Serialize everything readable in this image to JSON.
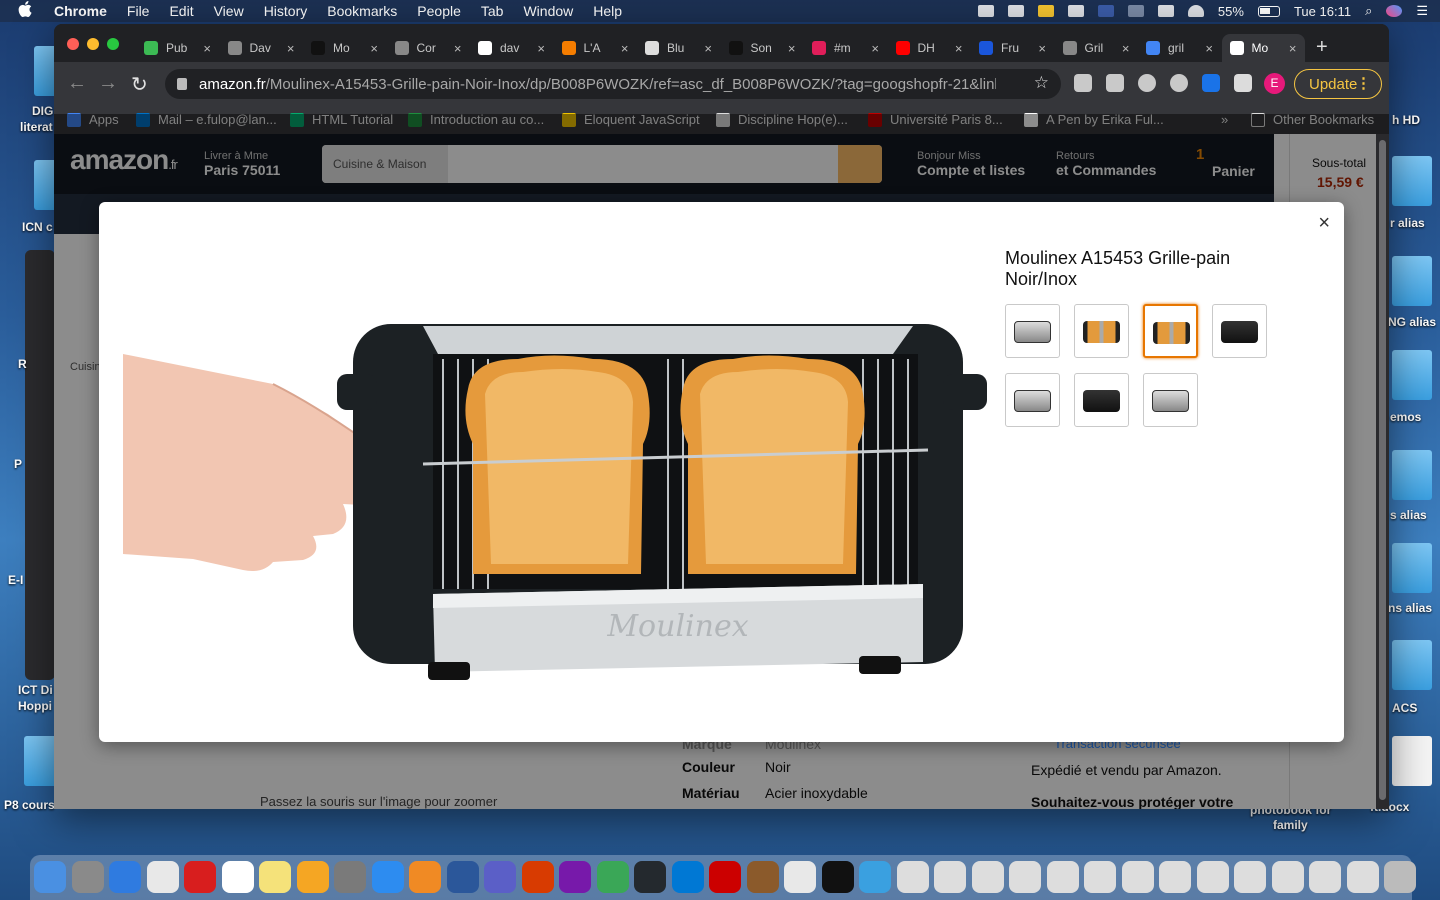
{
  "menubar": {
    "apple": "",
    "app": "Chrome",
    "items": [
      "File",
      "Edit",
      "View",
      "History",
      "Bookmarks",
      "People",
      "Tab",
      "Window",
      "Help"
    ],
    "battery": "55%",
    "clock": "Tue 16:11"
  },
  "desktop": {
    "labels": [
      "DIG",
      "literat",
      "ICN c",
      "R",
      "P",
      "E-I",
      "ICT Di",
      "Hoppi",
      "P8 cours",
      "h HD",
      "r alias",
      "NG alias",
      "emos",
      "s alias",
      "ns alias",
      "ACS",
      "photobook for",
      "family",
      "ft.docx"
    ]
  },
  "browser": {
    "tabs": [
      {
        "title": "Pub",
        "color": "#3cba54"
      },
      {
        "title": "Dav",
        "color": "#888888"
      },
      {
        "title": "Mo",
        "color": "#111111"
      },
      {
        "title": "Cor",
        "color": "#888888"
      },
      {
        "title": "dav",
        "color": "#ffffff"
      },
      {
        "title": "L'A",
        "color": "#f57d00"
      },
      {
        "title": "Blu",
        "color": "#dddddd"
      },
      {
        "title": "Son",
        "color": "#111111"
      },
      {
        "title": "#m",
        "color": "#e01e5a"
      },
      {
        "title": "DH",
        "color": "#ff0000"
      },
      {
        "title": "Fru",
        "color": "#1a56db"
      },
      {
        "title": "Gril",
        "color": "#888888"
      },
      {
        "title": "gril",
        "color": "#4285f4"
      },
      {
        "title": "Mo",
        "color": "#ffffff"
      }
    ],
    "active_tab": 13,
    "close_glyph": "×",
    "new_tab": "+",
    "url_host": "amazon.fr",
    "url_path": "/Moulinex-A15453-Grille-pain-Noir-Inox/dp/B008P6WOZK/ref=asc_df_B008P6WOZK/?tag=googshopfr-21&linkC...",
    "profile_initial": "E",
    "update_label": "Update",
    "bookmarks": [
      {
        "label": "Apps",
        "color": "#4285f4"
      },
      {
        "label": "Mail – e.fulop@lan...",
        "color": "#0072c6"
      },
      {
        "label": "HTML Tutorial",
        "color": "#04aa6d"
      },
      {
        "label": "Introduction au co...",
        "color": "#1e8e3e"
      },
      {
        "label": "Eloquent JavaScript",
        "color": "#f0c400"
      },
      {
        "label": "Discipline Hop(e)...",
        "color": "#dddddd"
      },
      {
        "label": "Université Paris 8...",
        "color": "#c00000"
      },
      {
        "label": "A Pen by Erika Ful...",
        "color": "#ffffff"
      }
    ],
    "bookmarks_more": "»",
    "other_bookmarks": "Other Bookmarks"
  },
  "amazon": {
    "logo": "amazon",
    "logo_tld": ".fr",
    "deliver_line1": "Livrer à Mme",
    "deliver_line2": "Paris 75011",
    "search_category": "Cuisine & Maison",
    "account_line1": "Bonjour Miss",
    "account_line2": "Compte et listes",
    "returns_line1": "Retours",
    "returns_line2": "et Commandes",
    "cart_count": "1",
    "cart_label": "Panier",
    "subtotal_label": "Sous-total",
    "subtotal_value": "15,59 €",
    "breadcrumb": "Cuisin",
    "spec_brand_label": "Marque",
    "spec_brand_value": "Moulinex",
    "spec_color_label": "Couleur",
    "spec_color_value": "Noir",
    "spec_material_label": "Matériau",
    "spec_material_value": "Acier inoxydable",
    "zoom_hint": "Passez la souris sur l'image pour zoomer",
    "secure": "Transaction sécurisée",
    "sold_by": "Expédié et vendu par Amazon.",
    "protect": "Souhaitez-vous protéger votre"
  },
  "modal": {
    "title": "Moulinex A15453 Grille-pain Noir/Inox",
    "close": "×",
    "brand_on_toaster": "Moulinex",
    "thumbnails": [
      {
        "kind": "steel"
      },
      {
        "kind": "toast"
      },
      {
        "kind": "toast"
      },
      {
        "kind": "dark"
      },
      {
        "kind": "steel"
      },
      {
        "kind": "dark"
      },
      {
        "kind": "steel"
      }
    ],
    "selected_thumbnail": 2
  }
}
